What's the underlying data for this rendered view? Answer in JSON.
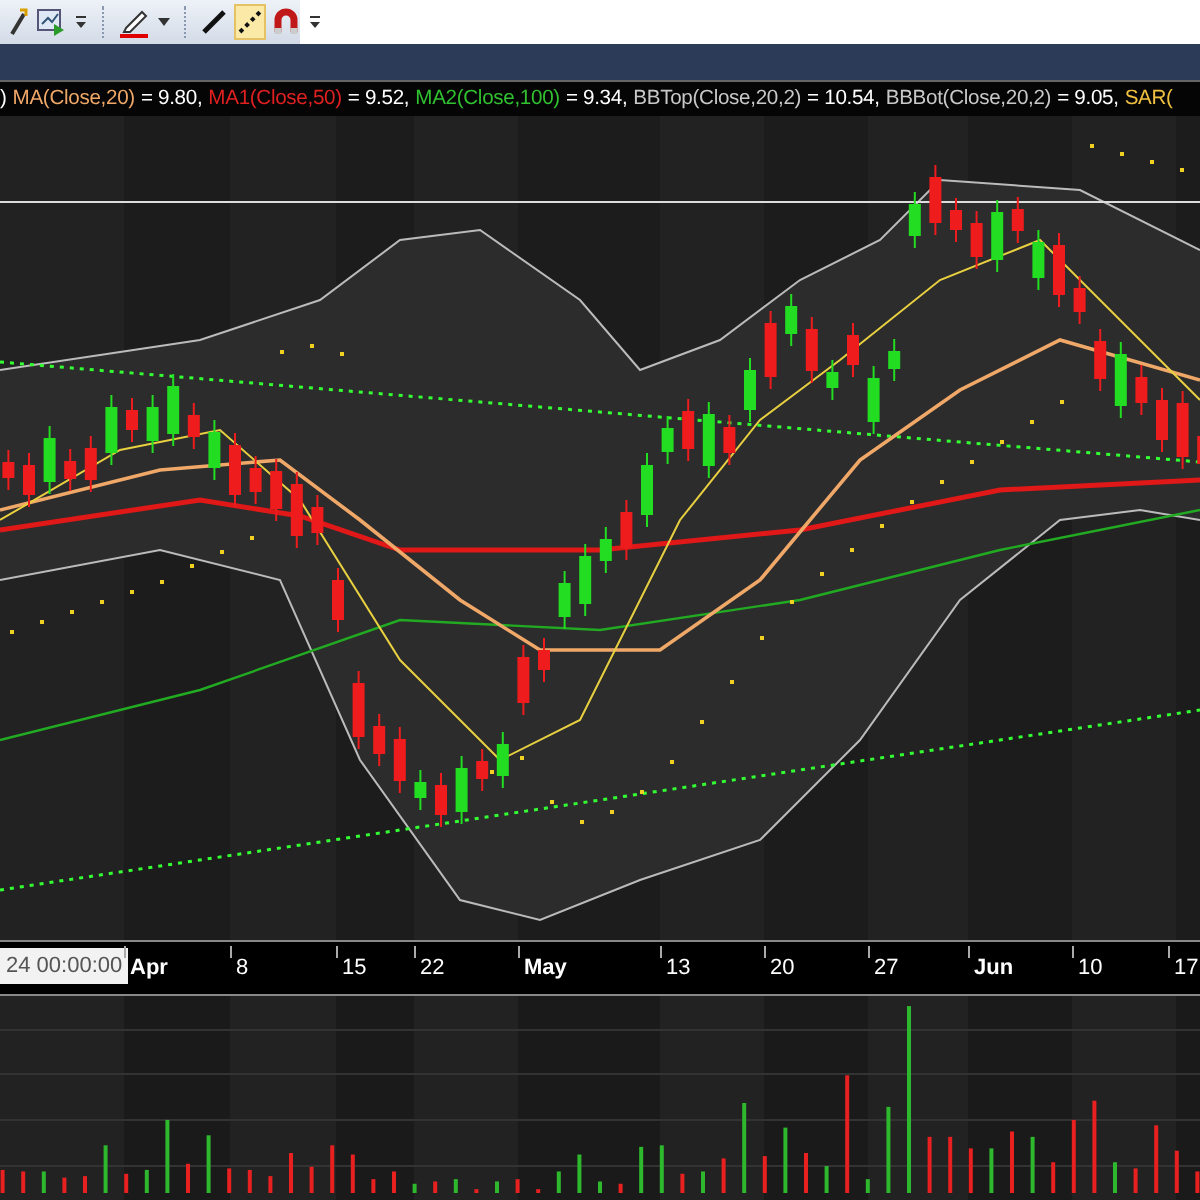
{
  "legend": [
    {
      "text": ")",
      "color": "#ffffff"
    },
    {
      "text": "MA(Close,20)",
      "color": "#f0a868"
    },
    {
      "text": "= 9.80,",
      "color": "#ffffff"
    },
    {
      "text": "MA1(Close,50)",
      "color": "#e02020"
    },
    {
      "text": "= 9.52,",
      "color": "#ffffff"
    },
    {
      "text": "MA2(Close,100)",
      "color": "#30c030"
    },
    {
      "text": "= 9.34,",
      "color": "#ffffff"
    },
    {
      "text": "BBTop(Close,20,2)",
      "color": "#c8c8c8"
    },
    {
      "text": "= 10.54,",
      "color": "#ffffff"
    },
    {
      "text": "BBBot(Close,20,2)",
      "color": "#c8c8c8"
    },
    {
      "text": "= 9.05,",
      "color": "#ffffff"
    },
    {
      "text": "SAR(",
      "color": "#f0c040"
    }
  ],
  "cursor_date": "24 00:00:00",
  "x_axis": [
    {
      "label": "Apr",
      "kind": "month"
    },
    {
      "label": "8",
      "kind": "day"
    },
    {
      "label": "15",
      "kind": "day"
    },
    {
      "label": "22",
      "kind": "day"
    },
    {
      "label": "May",
      "kind": "month"
    },
    {
      "label": "13",
      "kind": "day"
    },
    {
      "label": "20",
      "kind": "day"
    },
    {
      "label": "27",
      "kind": "day"
    },
    {
      "label": "Jun",
      "kind": "month"
    },
    {
      "label": "10",
      "kind": "day"
    },
    {
      "label": "17",
      "kind": "day"
    }
  ]
}
